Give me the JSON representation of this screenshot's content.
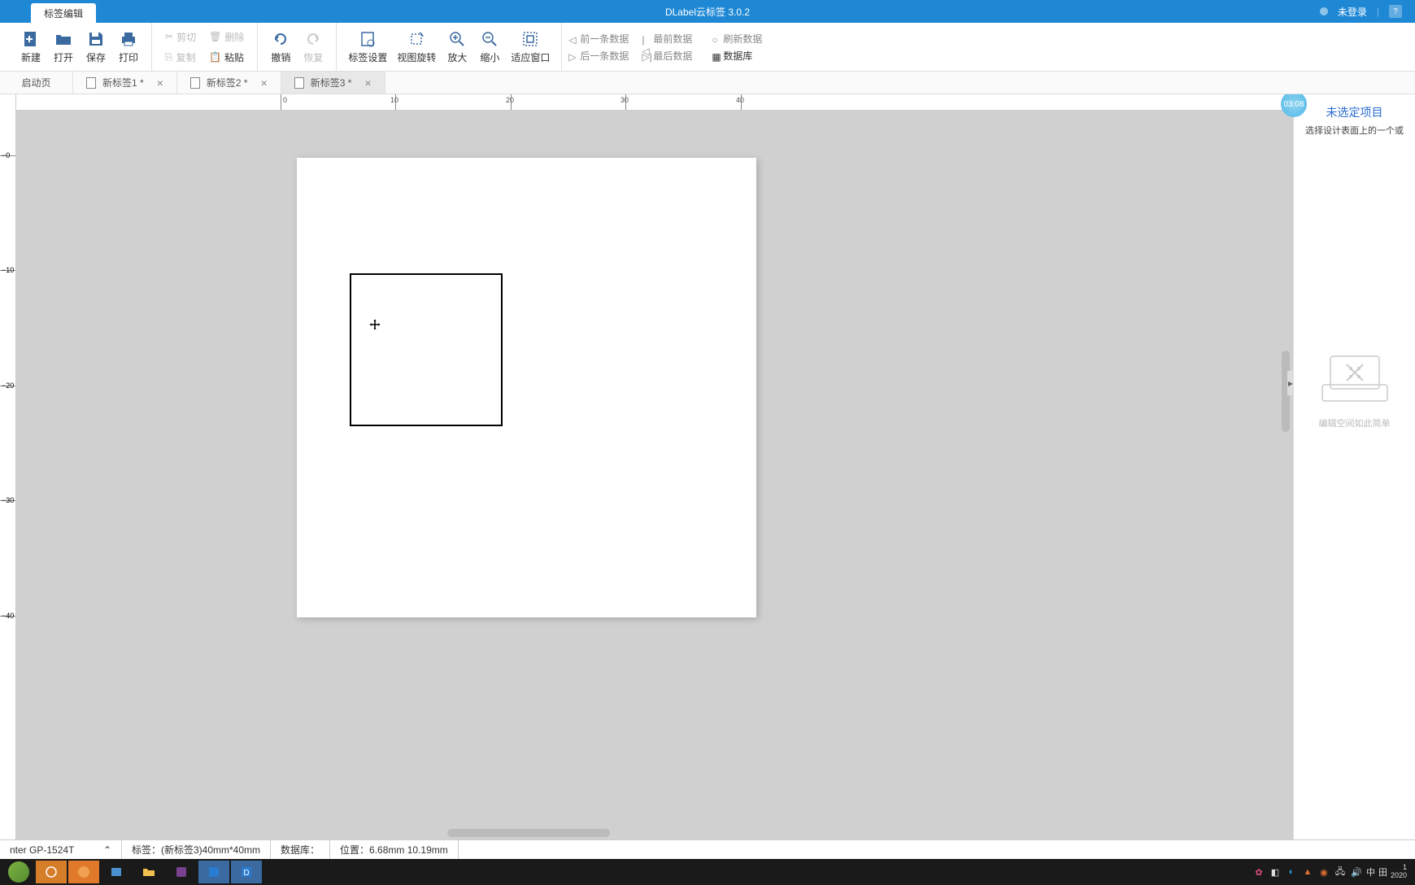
{
  "titlebar": {
    "tab_label": "标签编辑",
    "app_title": "DLabel云标签 3.0.2",
    "login_status": "未登录"
  },
  "toolbar": {
    "new": "新建",
    "open": "打开",
    "save": "保存",
    "print": "打印",
    "cut": "剪切",
    "copy": "复制",
    "delete": "删除",
    "paste": "粘贴",
    "undo": "撤销",
    "redo": "恢复",
    "label_settings": "标签设置",
    "view_rotate": "视图旋转",
    "zoom_in": "放大",
    "zoom_out": "缩小",
    "fit_window": "适应窗口",
    "prev_record": "前一条数据",
    "next_record": "后一条数据",
    "first_record": "最前数据",
    "last_record": "最后数据",
    "refresh_record": "刷新数据",
    "database": "数据库"
  },
  "tabs": {
    "start": "启动页",
    "t1": "新标签1 *",
    "t2": "新标签2 *",
    "t3": "新标签3 *"
  },
  "ruler": {
    "h": [
      "0",
      "10",
      "20",
      "30",
      "40"
    ],
    "v": [
      "0",
      "10",
      "20",
      "30",
      "40"
    ]
  },
  "right_panel": {
    "time_badge": "03:08",
    "title": "未选定项目",
    "subtitle": "选择设计表面上的一个或",
    "illust_caption": "编辑空间如此简单"
  },
  "statusbar": {
    "printer": "nter  GP-1524T",
    "label": "标签：(新标签3)40mm*40mm",
    "database": "数据库：",
    "position": "位置：6.68mm 10.19mm"
  },
  "taskbar": {
    "ime": "中",
    "tray_extra": "田",
    "year": "2020"
  }
}
